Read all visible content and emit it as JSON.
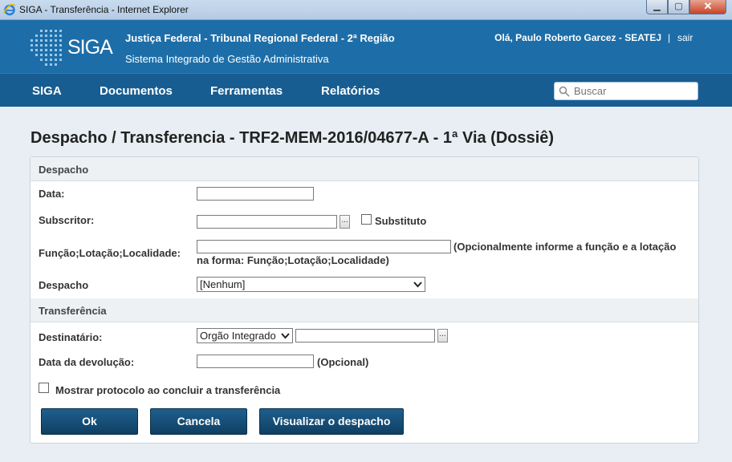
{
  "window": {
    "title": "SIGA - Transferência - Internet Explorer",
    "icon": "internet-explorer-icon"
  },
  "header": {
    "logo_text": "SIGA",
    "org": "Justiça Federal - Tribunal Regional Federal - 2ª Região",
    "system": "Sistema Integrado de Gestão Administrativa",
    "user_greeting": "Olá, Paulo Roberto Garcez - SEATEJ",
    "separator": "|",
    "logout": "sair"
  },
  "nav": {
    "items": [
      "SIGA",
      "Documentos",
      "Ferramentas",
      "Relatórios"
    ],
    "search_placeholder": "Buscar"
  },
  "page": {
    "title": "Despacho / Transferencia - TRF2-MEM-2016/04677-A - 1ª Via (Dossiê)"
  },
  "form": {
    "section_despacho": "Despacho",
    "data_label": "Data:",
    "data_value": "",
    "subscritor_label": "Subscritor:",
    "subscritor_value": "",
    "dots": "...",
    "substituto_label": "Substituto",
    "funcao_label": "Função;Lotação;Localidade:",
    "funcao_value": "",
    "funcao_note_1": "(Opcionalmente informe a função e a lotação",
    "funcao_note_2": "na forma: Função;Lotação;Localidade)",
    "despacho_label": "Despacho",
    "despacho_selected": "[Nenhum]",
    "section_transferencia": "Transferência",
    "destinatario_label": "Destinatário:",
    "destinatario_type": "Orgão Integrado",
    "destinatario_value": "",
    "devolucao_label": "Data da devolução:",
    "devolucao_value": "",
    "devolucao_note": "(Opcional)",
    "protocolo_label": "Mostrar protocolo ao concluir a transferência"
  },
  "buttons": {
    "ok": "Ok",
    "cancel": "Cancela",
    "preview": "Visualizar o despacho"
  },
  "colors": {
    "header": "#1d6ea8",
    "nav": "#175d91",
    "button": "#1a5583"
  }
}
